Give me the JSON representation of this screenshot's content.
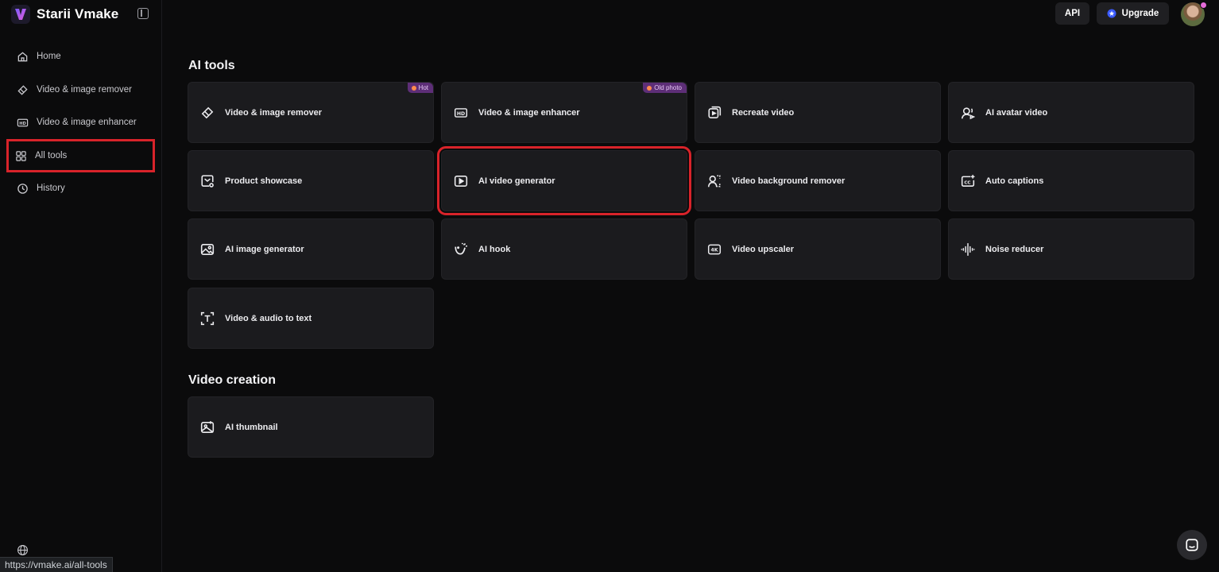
{
  "brand": {
    "name": "Starii Vmake"
  },
  "sidebar": {
    "items": [
      {
        "label": "Home",
        "icon": "home-icon"
      },
      {
        "label": "Video & image remover",
        "icon": "eraser-icon"
      },
      {
        "label": "Video & image enhancer",
        "icon": "hd-icon"
      },
      {
        "label": "All tools",
        "icon": "grid-icon",
        "active": true
      },
      {
        "label": "History",
        "icon": "clock-icon"
      }
    ]
  },
  "header": {
    "api_label": "API",
    "upgrade_label": "Upgrade"
  },
  "sections": [
    {
      "title": "AI tools",
      "cards": [
        {
          "label": "Video & image remover",
          "icon": "eraser-icon",
          "badge": "Hot"
        },
        {
          "label": "Video & image enhancer",
          "icon": "hd-icon",
          "badge": "Old photo"
        },
        {
          "label": "Recreate video",
          "icon": "recreate-icon"
        },
        {
          "label": "AI avatar video",
          "icon": "avatar-video-icon"
        },
        {
          "label": "Product showcase",
          "icon": "product-icon"
        },
        {
          "label": "AI video generator",
          "icon": "play-icon",
          "highlighted": true
        },
        {
          "label": "Video background remover",
          "icon": "person-bg-icon"
        },
        {
          "label": "Auto captions",
          "icon": "captions-icon"
        },
        {
          "label": "AI image generator",
          "icon": "image-icon"
        },
        {
          "label": "AI hook",
          "icon": "hook-icon"
        },
        {
          "label": "Video upscaler",
          "icon": "4k-icon"
        },
        {
          "label": "Noise reducer",
          "icon": "waveform-icon"
        },
        {
          "label": "Video & audio to text",
          "icon": "text-icon"
        }
      ]
    },
    {
      "title": "Video creation",
      "cards": [
        {
          "label": "AI thumbnail",
          "icon": "thumbnail-icon"
        }
      ]
    }
  ],
  "status_bar": {
    "url": "https://vmake.ai/all-tools"
  },
  "colors": {
    "background": "#0b0b0c",
    "card": "#1b1b1e",
    "highlight": "#d8232a",
    "badge": "#5d2e77",
    "logo_gradient": [
      "#7b5cff",
      "#e35bd8"
    ]
  }
}
